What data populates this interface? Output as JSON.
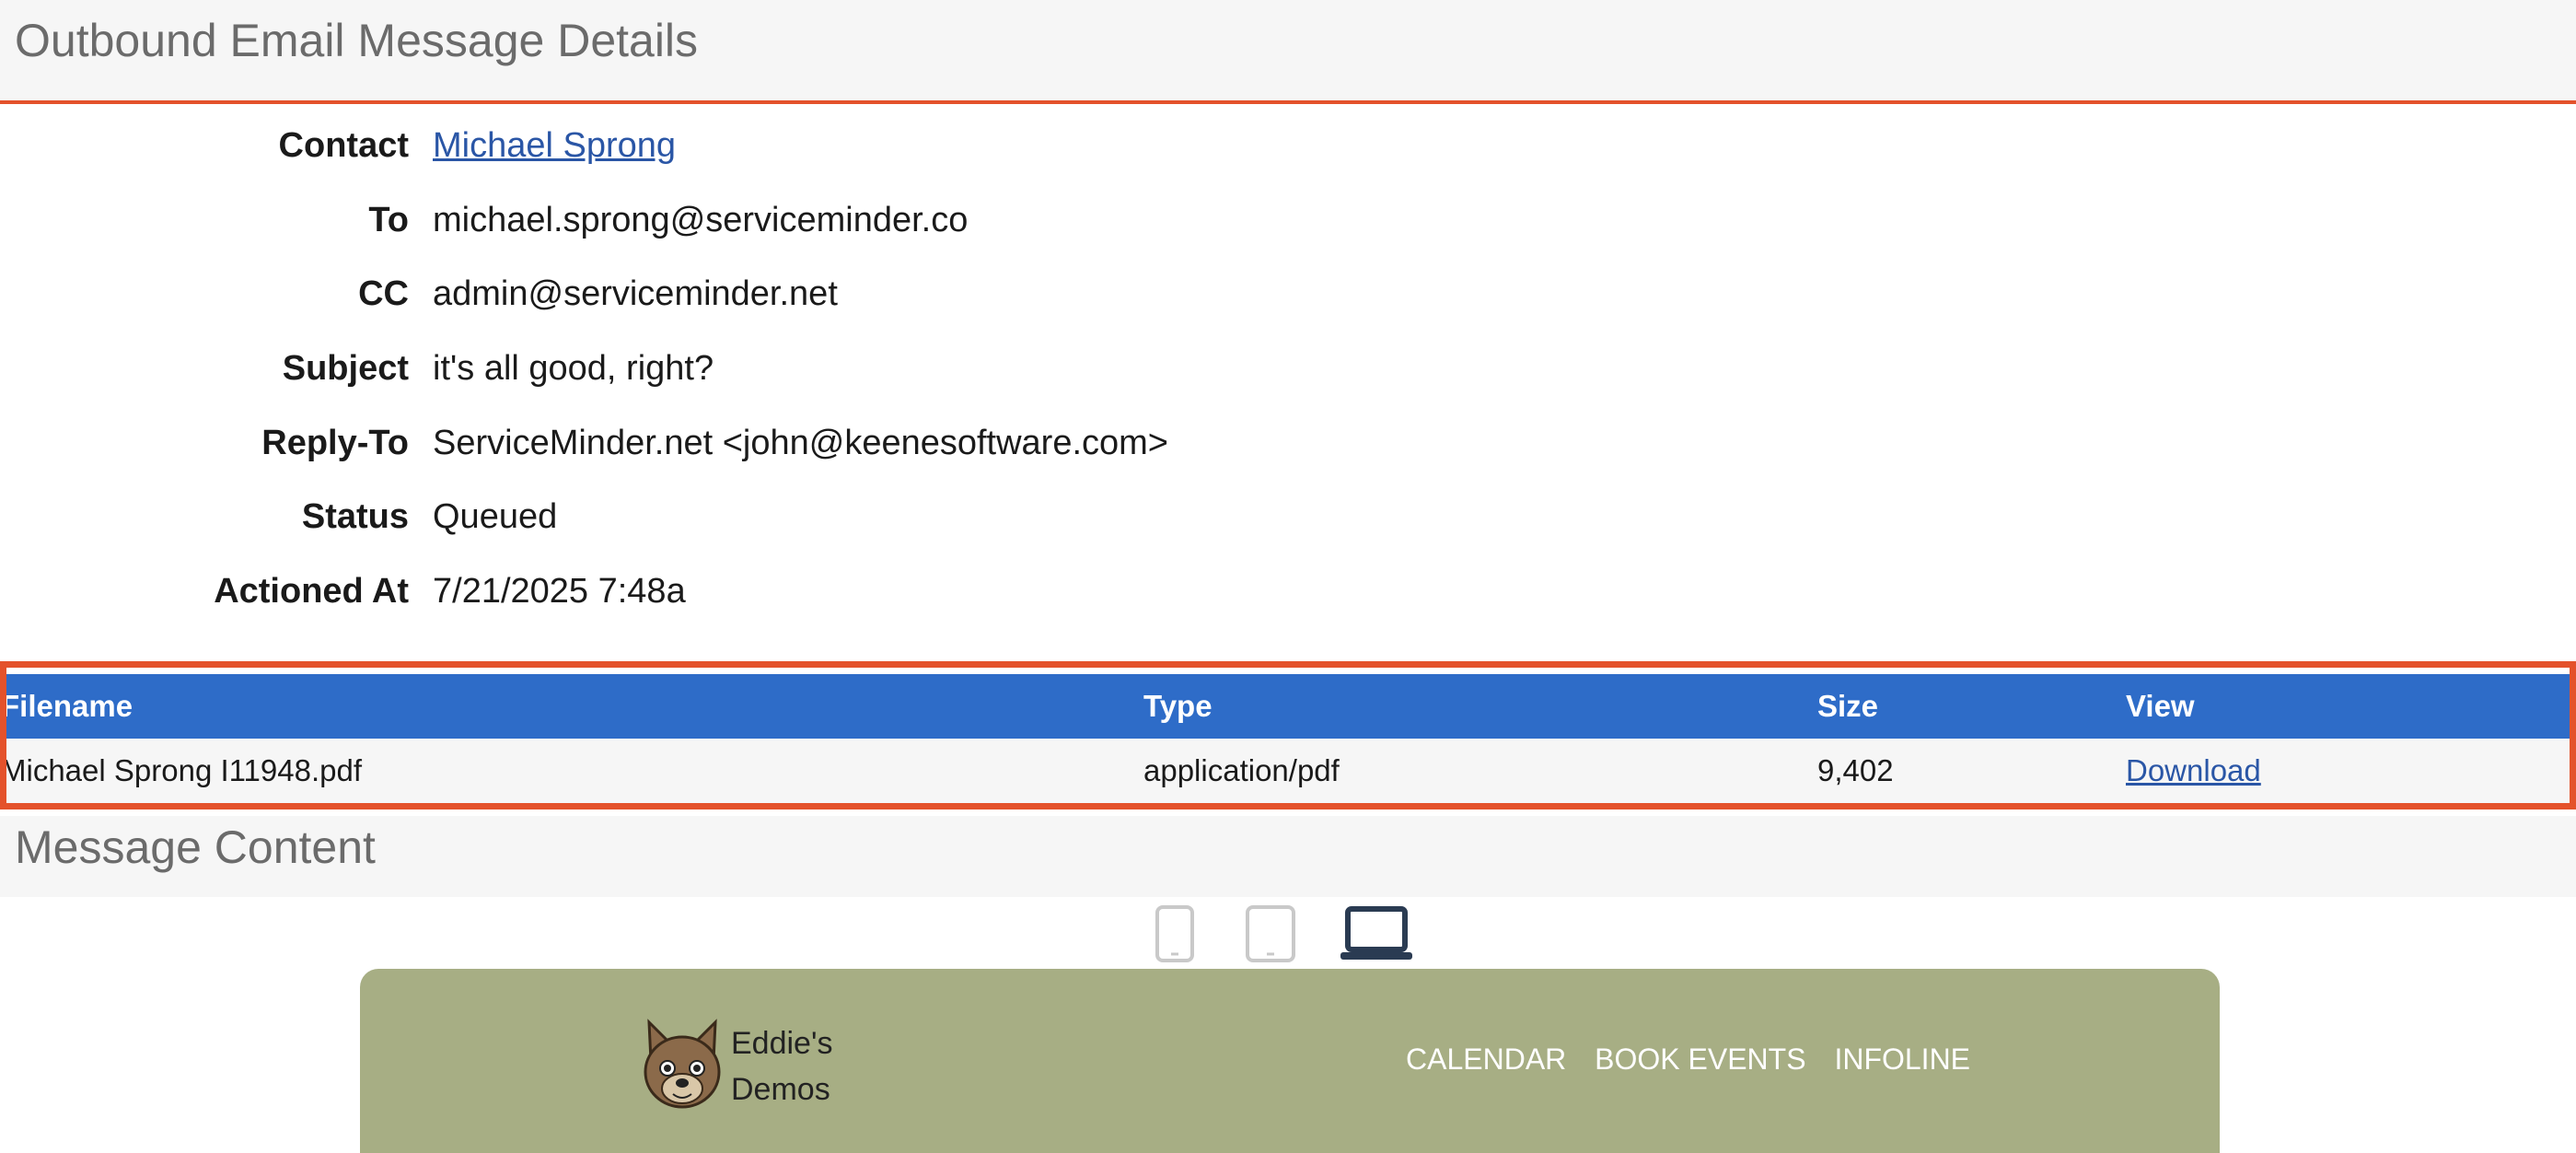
{
  "header": {
    "title": "Outbound Email Message Details"
  },
  "details": [
    {
      "label": "Contact",
      "value": "Michael Sprong",
      "is_link": true
    },
    {
      "label": "To",
      "value": "michael.sprong@serviceminder.co"
    },
    {
      "label": "CC",
      "value": "admin@serviceminder.net"
    },
    {
      "label": "Subject",
      "value": "it's all good, right?"
    },
    {
      "label": "Reply-To",
      "value": "ServiceMinder.net <john@keenesoftware.com>"
    },
    {
      "label": "Status",
      "value": "Queued"
    },
    {
      "label": "Actioned At",
      "value": "7/21/2025 7:48a"
    }
  ],
  "attachments": {
    "columns": [
      "Filename",
      "Type",
      "Size",
      "View"
    ],
    "rows": [
      {
        "filename": "Michael Sprong I11948.pdf",
        "type": "application/pdf",
        "size": "9,402",
        "view": "Download"
      }
    ]
  },
  "content_section": {
    "title": "Message Content"
  },
  "device_toggle": [
    {
      "icon": "mobile-portrait-icon",
      "active": false
    },
    {
      "icon": "tablet-icon",
      "active": false
    },
    {
      "icon": "laptop-icon",
      "active": true
    }
  ],
  "preview": {
    "logo_icon": "bulldog-icon",
    "brand_line1": "Eddie's",
    "brand_line2": "Demos",
    "nav": [
      "CALENDAR",
      "BOOK EVENTS",
      "INFOLINE"
    ],
    "bg_color": "#a7ae84"
  },
  "colors": {
    "accent": "#e4522b",
    "table_header": "#2e6cc8",
    "link": "#2a56a6"
  }
}
